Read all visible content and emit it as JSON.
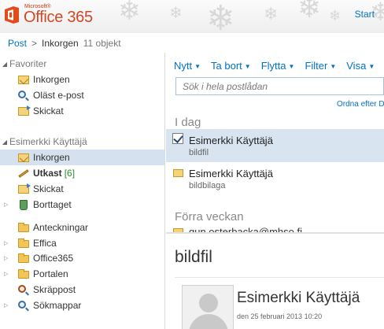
{
  "header": {
    "brand_prefix": "Microsoft®",
    "brand_name": "Office 365",
    "start_link": "Start"
  },
  "breadcrumb": {
    "root": "Post",
    "separator": ">",
    "current": "Inkorgen",
    "count": "11 objekt"
  },
  "nav": {
    "favorites": {
      "title": "Favoriter",
      "items": [
        {
          "label": "Inkorgen",
          "icon": "inbox-icon"
        },
        {
          "label": "Oläst e-post",
          "icon": "search-folder-icon"
        },
        {
          "label": "Skickat",
          "icon": "sent-icon"
        }
      ]
    },
    "mailbox": {
      "title": "Esimerkki Käyttäjä",
      "items": [
        {
          "label": "Inkorgen",
          "icon": "inbox-icon"
        },
        {
          "label": "Utkast",
          "unread": "[6]",
          "icon": "drafts-icon"
        },
        {
          "label": "Skickat",
          "icon": "sent-icon"
        },
        {
          "label": "Borttaget",
          "icon": "trash-icon"
        },
        {
          "label": "Anteckningar",
          "icon": "folder-icon"
        },
        {
          "label": "Effica",
          "icon": "folder-icon"
        },
        {
          "label": "Office365",
          "icon": "folder-icon"
        },
        {
          "label": "Portalen",
          "icon": "folder-icon"
        },
        {
          "label": "Skräppost",
          "icon": "junk-icon"
        },
        {
          "label": "Sökmappar",
          "icon": "folder-icon"
        }
      ]
    }
  },
  "toolbar": {
    "buttons": [
      "Nytt",
      "Ta bort",
      "Flytta",
      "Filter",
      "Visa"
    ]
  },
  "search": {
    "placeholder": "Sök i hela postlådan"
  },
  "list": {
    "sort_label": "Ordna efter D",
    "groups": {
      "today": "I dag",
      "last_week": "Förra veckan"
    },
    "messages": [
      {
        "from": "Esimerkki Käyttäjä",
        "subject": "bildfil"
      },
      {
        "from": "Esimerkki Käyttäjä",
        "subject": "bildbilaga"
      }
    ],
    "partial_sender": "gun.osterbacka@mhso.fi"
  },
  "reading_pane": {
    "subject": "bildfil",
    "from": "Esimerkki Käyttäjä",
    "date": "den 25 februari 2013 10:20"
  },
  "colors": {
    "accent": "#0072c6",
    "brand": "#d24726",
    "selection": "#d5e1ee"
  }
}
